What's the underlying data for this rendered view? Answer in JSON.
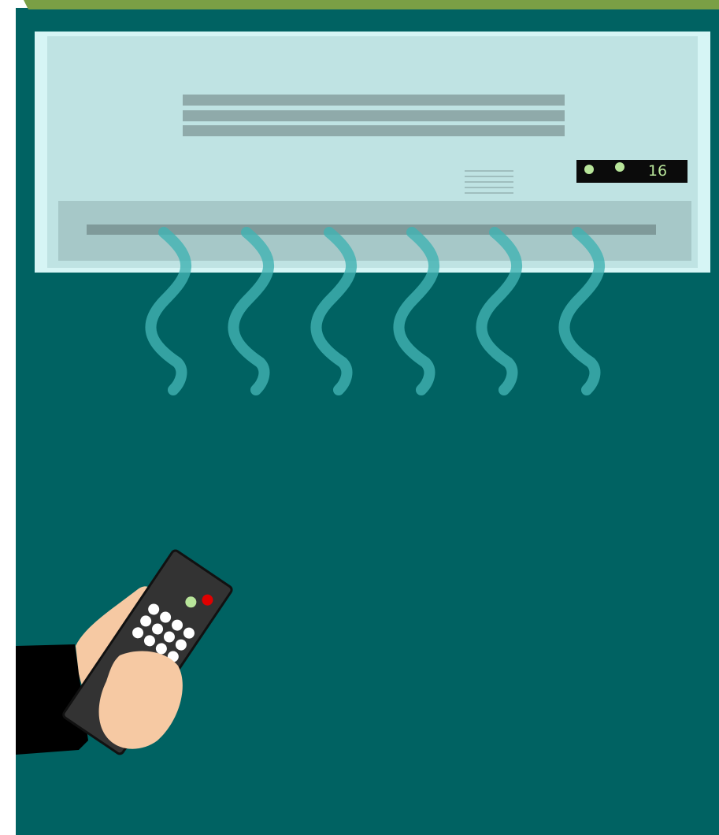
{
  "ac_unit": {
    "display": {
      "temperature": "16"
    }
  },
  "colors": {
    "background": "#006262",
    "top_band": "#7a9f45",
    "unit_body": "#bfe3e3",
    "unit_border": "#d6f5f5",
    "vent_bars": "#8faaaa",
    "louver": "#a6c8c8",
    "display_bg": "#0b0b0b",
    "display_led": "#b8e59a",
    "airflow": "#41b3b3",
    "remote_body": "#333333",
    "remote_button": "#ffffff",
    "remote_red_led": "#e00000",
    "remote_green_led": "#b8e59a",
    "skin": "#f6c9a3",
    "sleeve": "#000000"
  },
  "icons": [
    "air-conditioner-icon",
    "airflow-wave-icon",
    "remote-control-icon",
    "hand-icon"
  ]
}
